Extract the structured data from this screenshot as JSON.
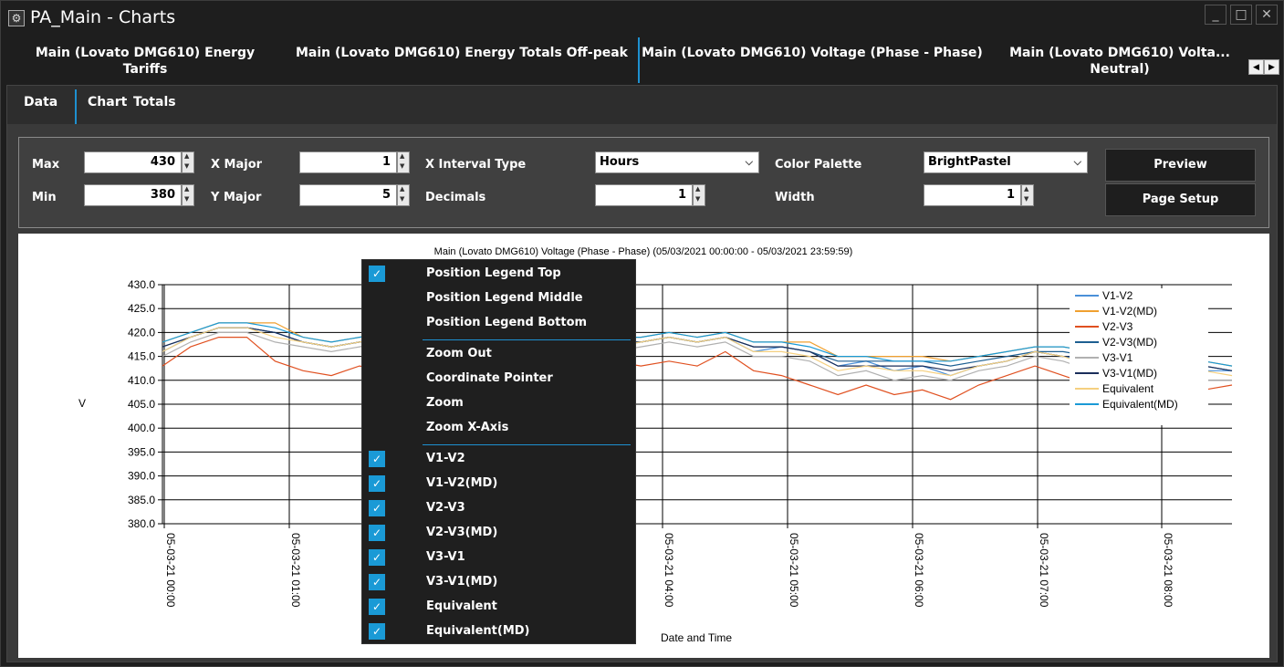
{
  "window": {
    "title": "PA_Main - Charts",
    "controls": [
      "_",
      "□",
      "✕"
    ]
  },
  "top_tabs": [
    {
      "label": "Main (Lovato DMG610) Energy Tariffs"
    },
    {
      "label": "Main (Lovato DMG610) Energy Totals Off-peak"
    },
    {
      "label": "Main (Lovato DMG610) Voltage (Phase - Phase)"
    },
    {
      "label": "Main (Lovato DMG610) Volta... Neutral)"
    }
  ],
  "sub_tabs": {
    "data": "Data",
    "chart": "Chart",
    "totals": "Totals"
  },
  "controls": {
    "max_label": "Max",
    "max_value": "430",
    "min_label": "Min",
    "min_value": "380",
    "xmajor_label": "X Major",
    "xmajor_value": "1",
    "ymajor_label": "Y Major",
    "ymajor_value": "5",
    "xinterval_label": "X Interval Type",
    "xinterval_value": "Hours",
    "decimals_label": "Decimals",
    "decimals_value": "1",
    "palette_label": "Color Palette",
    "palette_value": "BrightPastel",
    "width_label": "Width",
    "width_value": "1",
    "preview_label": "Preview",
    "pagesetup_label": "Page Setup"
  },
  "context_menu": {
    "items": [
      {
        "label": "Position Legend Top",
        "checked": true
      },
      {
        "label": "Position Legend Middle",
        "checked": false
      },
      {
        "label": "Position Legend Bottom",
        "checked": false
      },
      {
        "label": "Zoom Out",
        "checked": false
      },
      {
        "label": "Coordinate Pointer",
        "checked": false
      },
      {
        "label": "Zoom",
        "checked": false
      },
      {
        "label": "Zoom X-Axis",
        "checked": false
      },
      {
        "label": "V1-V2",
        "checked": true
      },
      {
        "label": "V1-V2(MD)",
        "checked": true
      },
      {
        "label": "V2-V3",
        "checked": true
      },
      {
        "label": "V2-V3(MD)",
        "checked": true
      },
      {
        "label": "V3-V1",
        "checked": true
      },
      {
        "label": "V3-V1(MD)",
        "checked": true
      },
      {
        "label": "Equivalent",
        "checked": true
      },
      {
        "label": "Equivalent(MD)",
        "checked": true
      }
    ]
  },
  "chart_data": {
    "type": "line",
    "title": "Main (Lovato DMG610) Voltage (Phase - Phase) (05/03/2021 00:00:00 - 05/03/2021 23:59:59)",
    "xlabel": "Date and Time",
    "ylabel": "V",
    "ylim": [
      380,
      430
    ],
    "y_ticks": [
      "430.0",
      "425.0",
      "420.0",
      "415.0",
      "410.0",
      "405.0",
      "400.0",
      "395.0",
      "390.0",
      "385.0",
      "380.0"
    ],
    "x_ticks": [
      "05-03-21 00:00",
      "05-03-21 01:00",
      "05-03-21 04:00",
      "05-03-21 05:00",
      "05-03-21 06:00",
      "05-03-21 07:00",
      "05-03-21 08:00"
    ],
    "legend_position": "top-right",
    "grid": true,
    "series": [
      {
        "name": "V1-V2",
        "color": "#4a90d9",
        "values": [
          416,
          419,
          421,
          421,
          420,
          418,
          417,
          418,
          419,
          418,
          417,
          418,
          418,
          419,
          417,
          418,
          417,
          418,
          419,
          418,
          419,
          416,
          417,
          416,
          413,
          414,
          412,
          413,
          411,
          413,
          414,
          416,
          415,
          414,
          413,
          414,
          413,
          412,
          412
        ]
      },
      {
        "name": "V1-V2(MD)",
        "color": "#f0a030",
        "values": [
          418,
          420,
          422,
          422,
          422,
          419,
          418,
          419,
          420,
          419,
          419,
          420,
          420,
          420,
          419,
          419,
          419,
          419,
          420,
          419,
          420,
          418,
          418,
          418,
          415,
          415,
          415,
          415,
          414,
          415,
          416,
          417,
          417,
          416,
          416,
          416,
          416,
          414,
          413
        ]
      },
      {
        "name": "V2-V3",
        "color": "#e05020",
        "values": [
          413,
          417,
          419,
          419,
          414,
          412,
          411,
          413,
          412,
          413,
          414,
          413,
          412,
          415,
          412,
          414,
          414,
          413,
          414,
          413,
          416,
          412,
          411,
          409,
          407,
          409,
          407,
          408,
          406,
          409,
          411,
          413,
          411,
          409,
          407,
          409,
          409,
          408,
          409
        ]
      },
      {
        "name": "V2-V3(MD)",
        "color": "#1d5f91",
        "values": [
          417,
          419,
          421,
          421,
          420,
          418,
          417,
          418,
          419,
          418,
          418,
          419,
          419,
          419,
          418,
          418,
          418,
          418,
          419,
          418,
          419,
          417,
          417,
          416,
          414,
          414,
          414,
          414,
          413,
          414,
          415,
          416,
          416,
          415,
          415,
          415,
          414,
          413,
          412
        ]
      },
      {
        "name": "V3-V1",
        "color": "#b0b0b0",
        "values": [
          415,
          418,
          420,
          420,
          418,
          417,
          416,
          417,
          418,
          417,
          416,
          417,
          417,
          418,
          416,
          417,
          416,
          417,
          418,
          417,
          418,
          415,
          415,
          414,
          411,
          412,
          410,
          411,
          410,
          412,
          413,
          415,
          414,
          412,
          411,
          412,
          411,
          410,
          410
        ]
      },
      {
        "name": "V3-V1(MD)",
        "color": "#1a2e5a",
        "values": [
          417,
          419,
          421,
          421,
          420,
          418,
          417,
          418,
          419,
          418,
          418,
          419,
          419,
          419,
          418,
          418,
          418,
          418,
          419,
          418,
          419,
          417,
          417,
          416,
          413,
          413,
          413,
          413,
          412,
          413,
          414,
          416,
          415,
          415,
          415,
          415,
          415,
          413,
          412
        ]
      },
      {
        "name": "Equivalent",
        "color": "#f5d080",
        "values": [
          416,
          419,
          421,
          421,
          419,
          418,
          417,
          418,
          419,
          418,
          417,
          418,
          418,
          419,
          417,
          418,
          417,
          418,
          419,
          418,
          419,
          416,
          416,
          415,
          412,
          413,
          412,
          412,
          411,
          413,
          414,
          416,
          415,
          413,
          412,
          413,
          412,
          412,
          411
        ]
      },
      {
        "name": "Equivalent(MD)",
        "color": "#1a9ad6",
        "values": [
          418,
          420,
          422,
          422,
          421,
          419,
          418,
          419,
          420,
          419,
          419,
          420,
          420,
          420,
          419,
          419,
          419,
          419,
          420,
          419,
          420,
          418,
          418,
          417,
          415,
          415,
          414,
          414,
          414,
          415,
          416,
          417,
          417,
          416,
          416,
          416,
          416,
          414,
          413
        ]
      }
    ]
  }
}
